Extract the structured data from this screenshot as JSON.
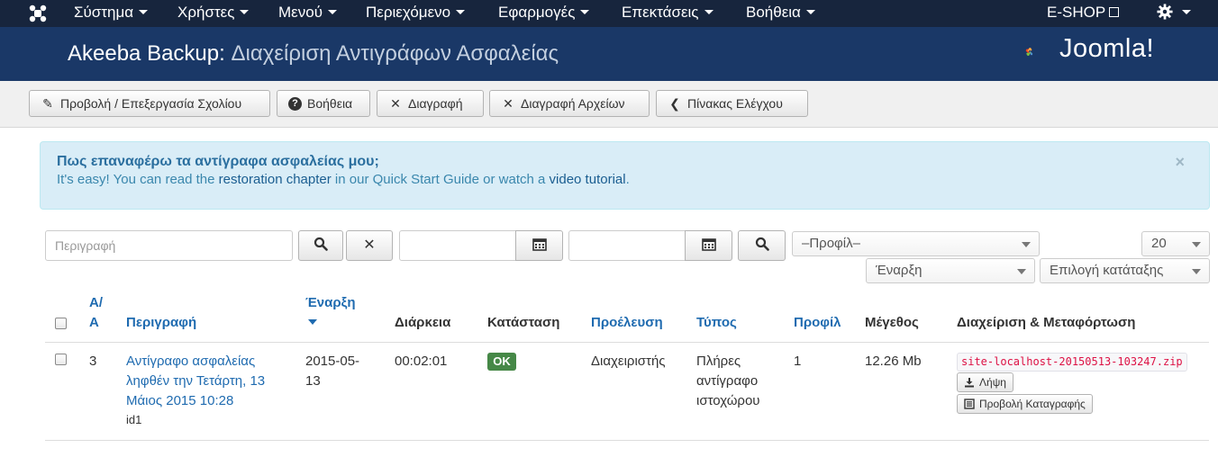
{
  "topnav": {
    "menus": [
      "Σύστημα",
      "Χρήστες",
      "Μενού",
      "Περιεχόμενο",
      "Εφαρμογές",
      "Επεκτάσεις",
      "Βοήθεια"
    ],
    "site_link": "E-SHOP",
    "settings_icon": "gear-icon"
  },
  "header": {
    "title_prefix": "Akeeba Backup:",
    "title_sub": "Διαχείριση Αντιγράφων Ασφαλείας",
    "brand": "Joomla!"
  },
  "toolbar": {
    "buttons": [
      {
        "label": "Προβολή / Επεξεργασία Σχολίου",
        "icon": "edit-icon"
      },
      {
        "label": "Βοήθεια",
        "icon": "help-icon"
      },
      {
        "label": "Διαγραφή",
        "icon": "x-icon"
      },
      {
        "label": "Διαγραφή Αρχείων",
        "icon": "x-icon"
      },
      {
        "label": "Πίνακας Ελέγχου",
        "icon": "chevron-left-icon"
      }
    ]
  },
  "alert": {
    "heading": "Πως επαναφέρω τα αντίγραφα ασφαλείας μου;",
    "text_1": "It's easy! You can read the",
    "link_1": "restoration chapter",
    "text_2": "in our Quick Start Guide or watch a",
    "link_2": "video tutorial",
    "text_3": ".",
    "close": "×"
  },
  "filters": {
    "description_placeholder": "Περιγραφή",
    "date_from": "",
    "date_to": "",
    "profile": "–Προφίλ–",
    "limit": "20",
    "order_by": "Έναρξη",
    "sort_dir": "Επιλογή κατάταξης"
  },
  "table": {
    "headers": {
      "id_line1": "Α/",
      "id_line2": "Α",
      "description": "Περιγραφή",
      "start": "Έναρξη",
      "duration": "Διάρκεια",
      "status": "Κατάσταση",
      "origin": "Προέλευση",
      "type": "Τύπος",
      "profile": "Προφίλ",
      "size": "Μέγεθος",
      "manage": "Διαχείριση & Μεταφόρτωση"
    },
    "rows": [
      {
        "id": "3",
        "description_line1": "Αντίγραφο ασφαλείας",
        "description_line2": "ληφθέν την Τετάρτη, 13",
        "description_line3": "Μάιος 2015 10:28",
        "description_sub": "id1",
        "start_line1": "2015-05-",
        "start_line2": "13",
        "duration": "00:02:01",
        "status": "OK",
        "origin": "Διαχειριστής",
        "type_line1": "Πλήρες",
        "type_line2": "αντίγραφο",
        "type_line3": "ιστοχώρου",
        "profile": "1",
        "size": "12.26 Mb",
        "filename": "site-localhost-20150513-103247.zip",
        "download_label": "Λήψη",
        "viewlog_label": "Προβολή Καταγραφής"
      }
    ]
  },
  "colors": {
    "topnav_bg": "#17253d",
    "header_bg": "#1a3867",
    "link": "#1f6bb0",
    "ok_badge": "#468847"
  }
}
